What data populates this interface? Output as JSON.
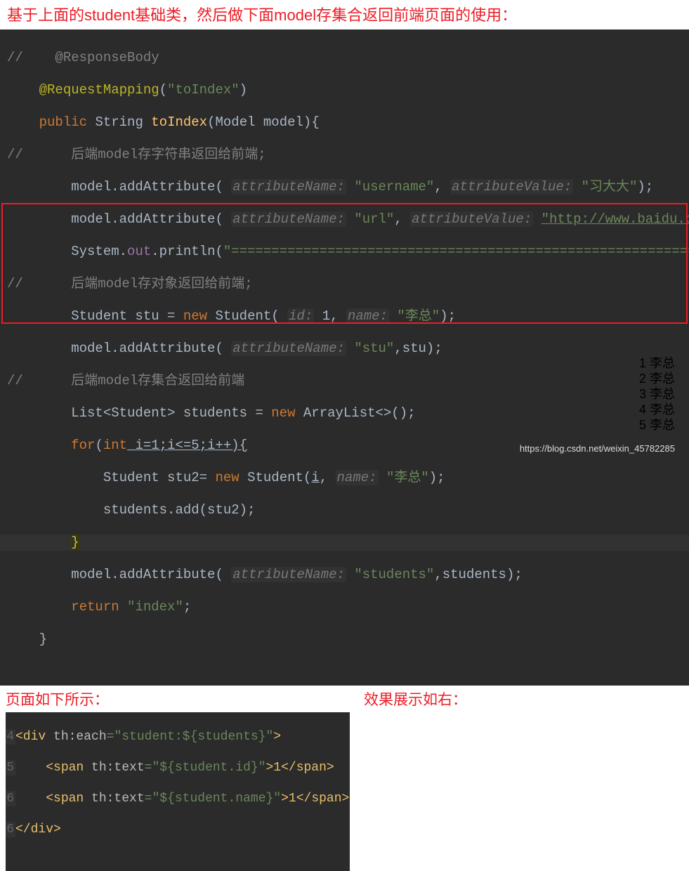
{
  "header": "基于上面的student基础类，然后做下面model存集合返回前端页面的使用：",
  "code": {
    "l1_annotation": "@ResponseBody",
    "l2_annotation": "@RequestMapping",
    "l2_value": "\"toIndex\"",
    "l3_public": "public",
    "l3_type": "String",
    "l3_method": "toIndex",
    "l3_params": "(Model model){",
    "l4_comment": "后端model存字符串返回给前端;",
    "l5_pre": "model.addAttribute(",
    "l5_hint1": "attributeName:",
    "l5_str1": "\"username\"",
    "l5_hint2": "attributeValue:",
    "l5_str2": "\"习大大\"",
    "l6_str1": "\"url\"",
    "l6_str2": "\"http://www.baidu.com\"",
    "l7_sys": "System.",
    "l7_out": "out",
    "l7_println": ".println(",
    "l7_str": "\"==================================================================\"",
    "l8_comment": "后端model存对象返回给前端;",
    "l9_pre": "Student stu = ",
    "l9_new": "new",
    "l9_student": " Student(",
    "l9_hint1": "id:",
    "l9_v1": "1",
    "l9_hint2": "name:",
    "l9_v2": "\"李总\"",
    "l10_str": "\"stu\"",
    "l10_end": ",stu);",
    "l11_comment": "后端model存集合返回给前端",
    "l12": "List<Student> students = ",
    "l12_new": "new",
    "l12_end": " ArrayList<>();",
    "l13_for": "for",
    "l13_int": "int",
    "l13_body": " i=1;i<=5;i++){",
    "l14_pre": "Student stu2= ",
    "l14_new": "new",
    "l14_s": " Student(",
    "l14_i": "i",
    "l14_hint": "name:",
    "l14_v": "\"李总\"",
    "l15": "students.add(stu2);",
    "l17_str": "\"students\"",
    "l17_end": ",students);",
    "l18_return": "return",
    "l18_str": "\"index\"",
    "brace_close": "}"
  },
  "bottom": {
    "left_title": "页面如下所示：",
    "right_title": "效果展示如右：",
    "html": {
      "l1_tag_open": "<div ",
      "l1_attr": "th:each",
      "l1_val": "\"student:${students}\"",
      "l1_close": ">",
      "l2_tag_open": "<span ",
      "l2_attr": "th:text",
      "l2_val": "\"${student.id}\"",
      "l2_text": ">1</span>",
      "l3_val": "\"${student.name}\"",
      "l3_text": ">1</span>",
      "l4": "</div>"
    },
    "results": [
      {
        "id": "1",
        "name": "李总"
      },
      {
        "id": "2",
        "name": "李总"
      },
      {
        "id": "3",
        "name": "李总"
      },
      {
        "id": "4",
        "name": "李总"
      },
      {
        "id": "5",
        "name": "李总"
      }
    ]
  },
  "watermark": "https://blog.csdn.net/weixin_45782285"
}
